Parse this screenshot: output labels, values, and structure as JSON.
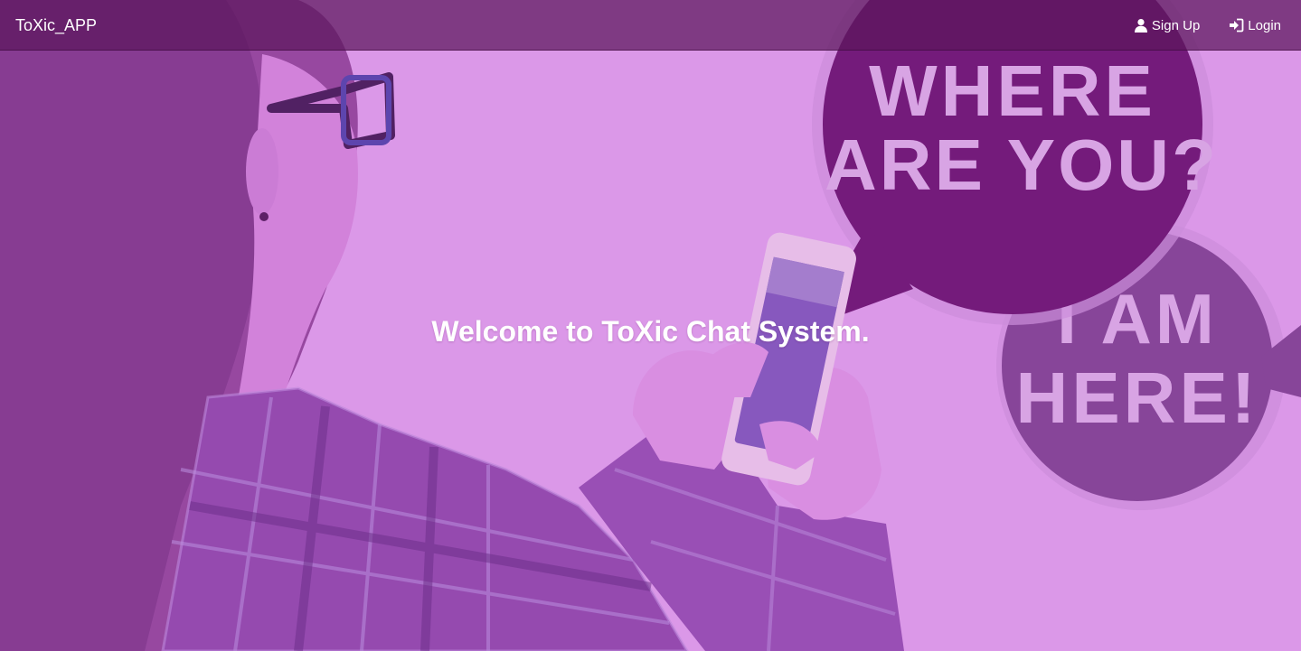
{
  "navbar": {
    "brand": "ToXic_APP",
    "signup_label": "Sign Up",
    "signup_icon": "user-icon",
    "login_label": "Login",
    "login_icon": "sign-in-icon"
  },
  "hero": {
    "welcome_text": "Welcome to ToXic Chat System.",
    "bubble_top": [
      "WHERE",
      "ARE YOU?"
    ],
    "bubble_bottom": [
      "I AM",
      "HERE!"
    ]
  },
  "colors": {
    "overlay": "#da98e8",
    "navbar": "#5c165c",
    "bubble_dark": "#650a6b",
    "bubble_mid": "#7a3a8e",
    "text": "#ffffff"
  }
}
